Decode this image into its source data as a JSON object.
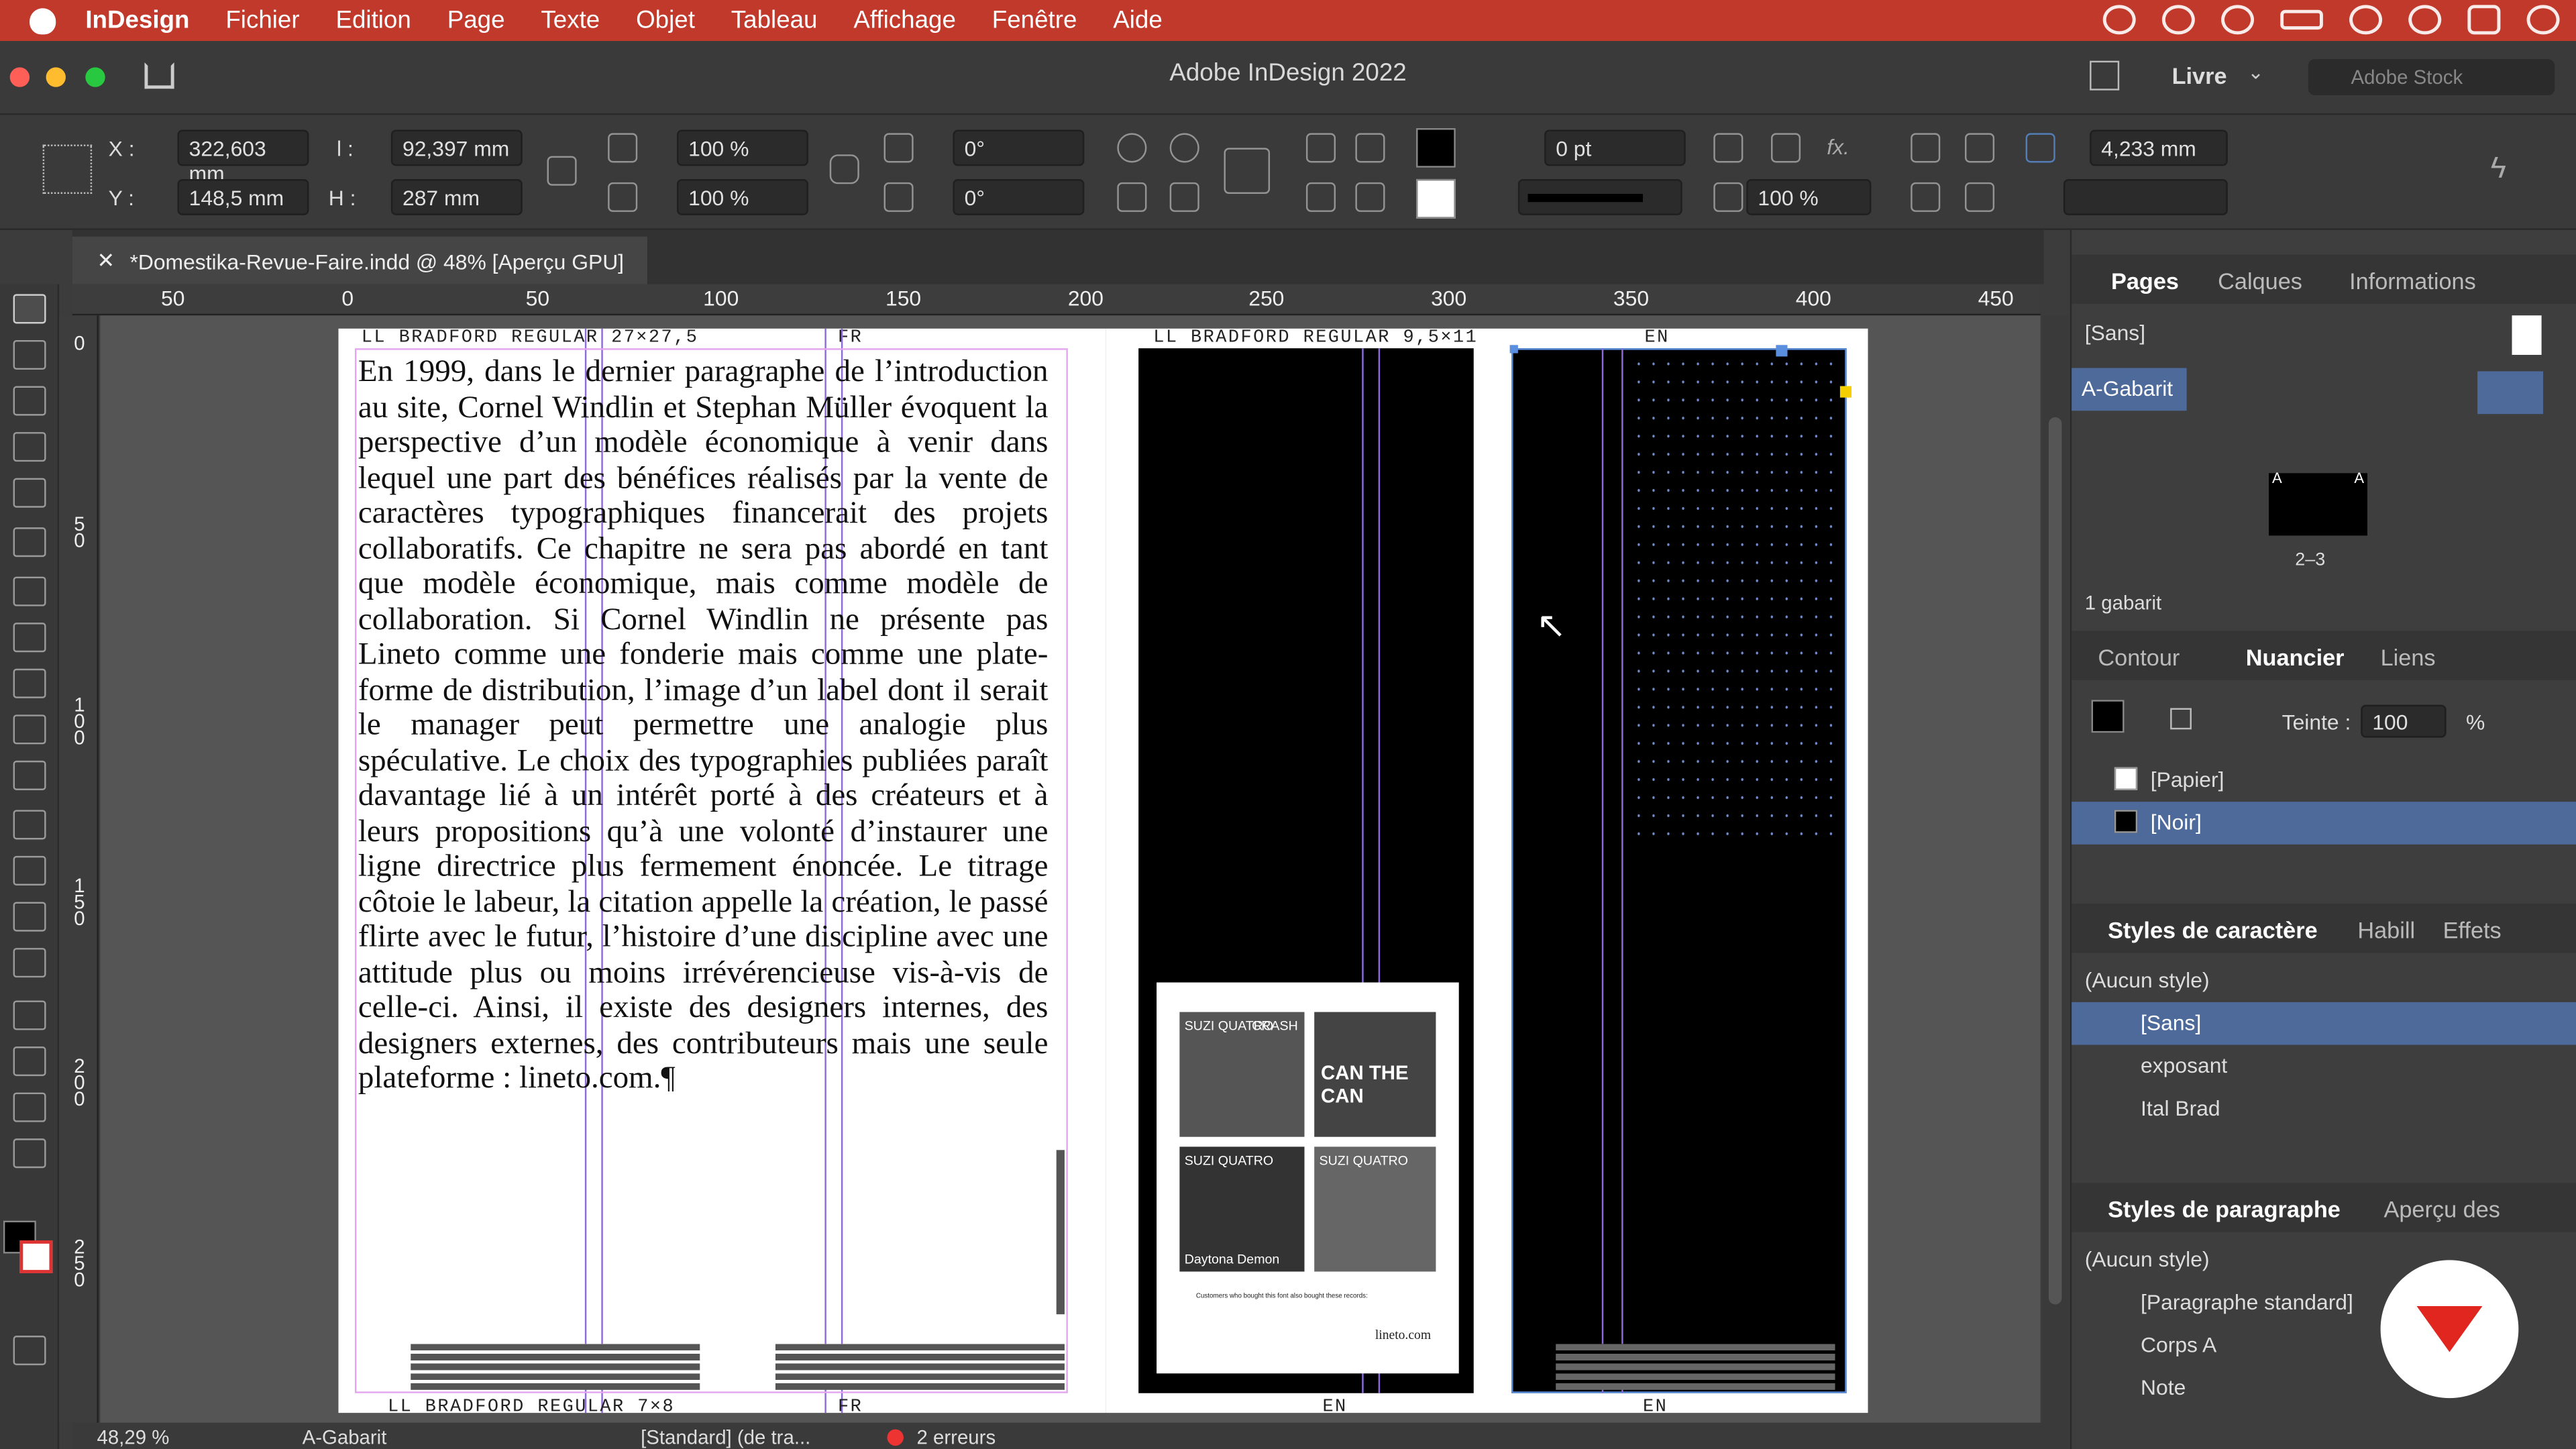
{
  "menubar": {
    "items": [
      "InDesign",
      "Fichier",
      "Edition",
      "Page",
      "Texte",
      "Objet",
      "Tableau",
      "Affichage",
      "Fenêtre",
      "Aide"
    ]
  },
  "window": {
    "title": "Adobe InDesign 2022",
    "workspace": "Livre",
    "stock_placeholder": "Adobe Stock"
  },
  "control": {
    "x_label": "X :",
    "x": "322,603 mm",
    "y_label": "Y :",
    "y": "148,5 mm",
    "w_label": "l :",
    "w": "92,397 mm",
    "h_label": "H :",
    "h": "287 mm",
    "scale_x": "100 %",
    "scale_y": "100 %",
    "angle1": "0°",
    "angle2": "0°",
    "stroke": "0 pt",
    "opacity": "100 %",
    "size": "4,233 mm"
  },
  "doc_tab": "*Domestika-Revue-Faire.indd @ 48% [Aperçu GPU]",
  "ruler_h": [
    "50",
    "0",
    "50",
    "100",
    "150",
    "200",
    "250",
    "300",
    "350",
    "400",
    "450"
  ],
  "ruler_v": [
    "0",
    "50",
    "100",
    "150",
    "200",
    "250"
  ],
  "page": {
    "header_left": "LL BRADFORD REGULAR 27×27,5",
    "header_fr": "FR",
    "header_right": "LL BRADFORD REGULAR 9,5×11",
    "header_en": "EN",
    "footer_left": "LL BRADFORD REGULAR 7×8",
    "footer_fr": "FR",
    "footer_en1": "EN",
    "footer_en2": "EN",
    "body": "En 1999, dans le dernier paragraphe de l’introduction au site, Cornel Windlin et Stephan Müller évoquent la perspective d’un modèle économique à venir dans lequel une part des bénéfices réalisés par la vente de caractères typographiques financerait des projets collaboratifs. Ce chapitre ne sera pas abordé en tant que modèle économique, mais comme modèle de collaboration. Si Cornel Windlin ne présente pas Lineto comme une fonderie mais comme une plate-forme de distribution, l’image d’un label dont il serait le manager peut permettre une analogie plus spéculative. Le choix des typographies publiées paraît davantage lié à un intérêt porté à des créateurs et à leurs propositions qu’à une volonté d’instaurer une ligne directrice plus fermement énoncée. Le titrage côtoie le labeur, la citation appelle la création, le passé flirte avec le futur, l’histoire d’une discipline avec une attitude plus ou moins irrévérencieuse vis-à-vis de celle-ci. Ainsi, il existe des designers internes, des designers externes, des contributeurs mais une seule plateforme : lineto.com.¶",
    "album_captions": [
      "SUZI QUATRO",
      "CRASH",
      "CAN THE CAN",
      "SUZI QUATRO",
      "Daytona Demon",
      "SUZI QUATRO"
    ],
    "album_footer": "Customers who bought this font also bought these records:",
    "album_url": "lineto.com"
  },
  "status": {
    "zoom": "48,29 %",
    "page": "A-Gabarit",
    "preflight_profile": "[Standard] (de tra...",
    "errors": "2 erreurs"
  },
  "panels": {
    "pages": {
      "tabs": [
        "Pages",
        "Calques",
        "Informations"
      ],
      "none": "[Sans]",
      "master": "A-Gabarit",
      "spread": "2–3",
      "count": "1 gabarit",
      "thumb_a1": "A",
      "thumb_a2": "A"
    },
    "swatches": {
      "tabs": [
        "Contour",
        "Nuancier",
        "Liens"
      ],
      "tint_label": "Teinte :",
      "tint": "100",
      "pct": "%",
      "items": [
        "[Papier]",
        "[Noir]"
      ]
    },
    "char_styles": {
      "tabs": [
        "Styles de caractère",
        "Habill",
        "Effets"
      ],
      "items": [
        "(Aucun style)",
        "[Sans]",
        "exposant",
        "Ital Brad"
      ]
    },
    "para_styles": {
      "tabs": [
        "Styles de paragraphe",
        "Aperçu des"
      ],
      "items": [
        "(Aucun style)",
        "[Paragraphe standard]",
        "Corps A",
        "Note"
      ]
    }
  },
  "colors": {
    "menubar": "#c0392b",
    "selection": "#4d6a9a",
    "guide": "#8e6bd8"
  }
}
